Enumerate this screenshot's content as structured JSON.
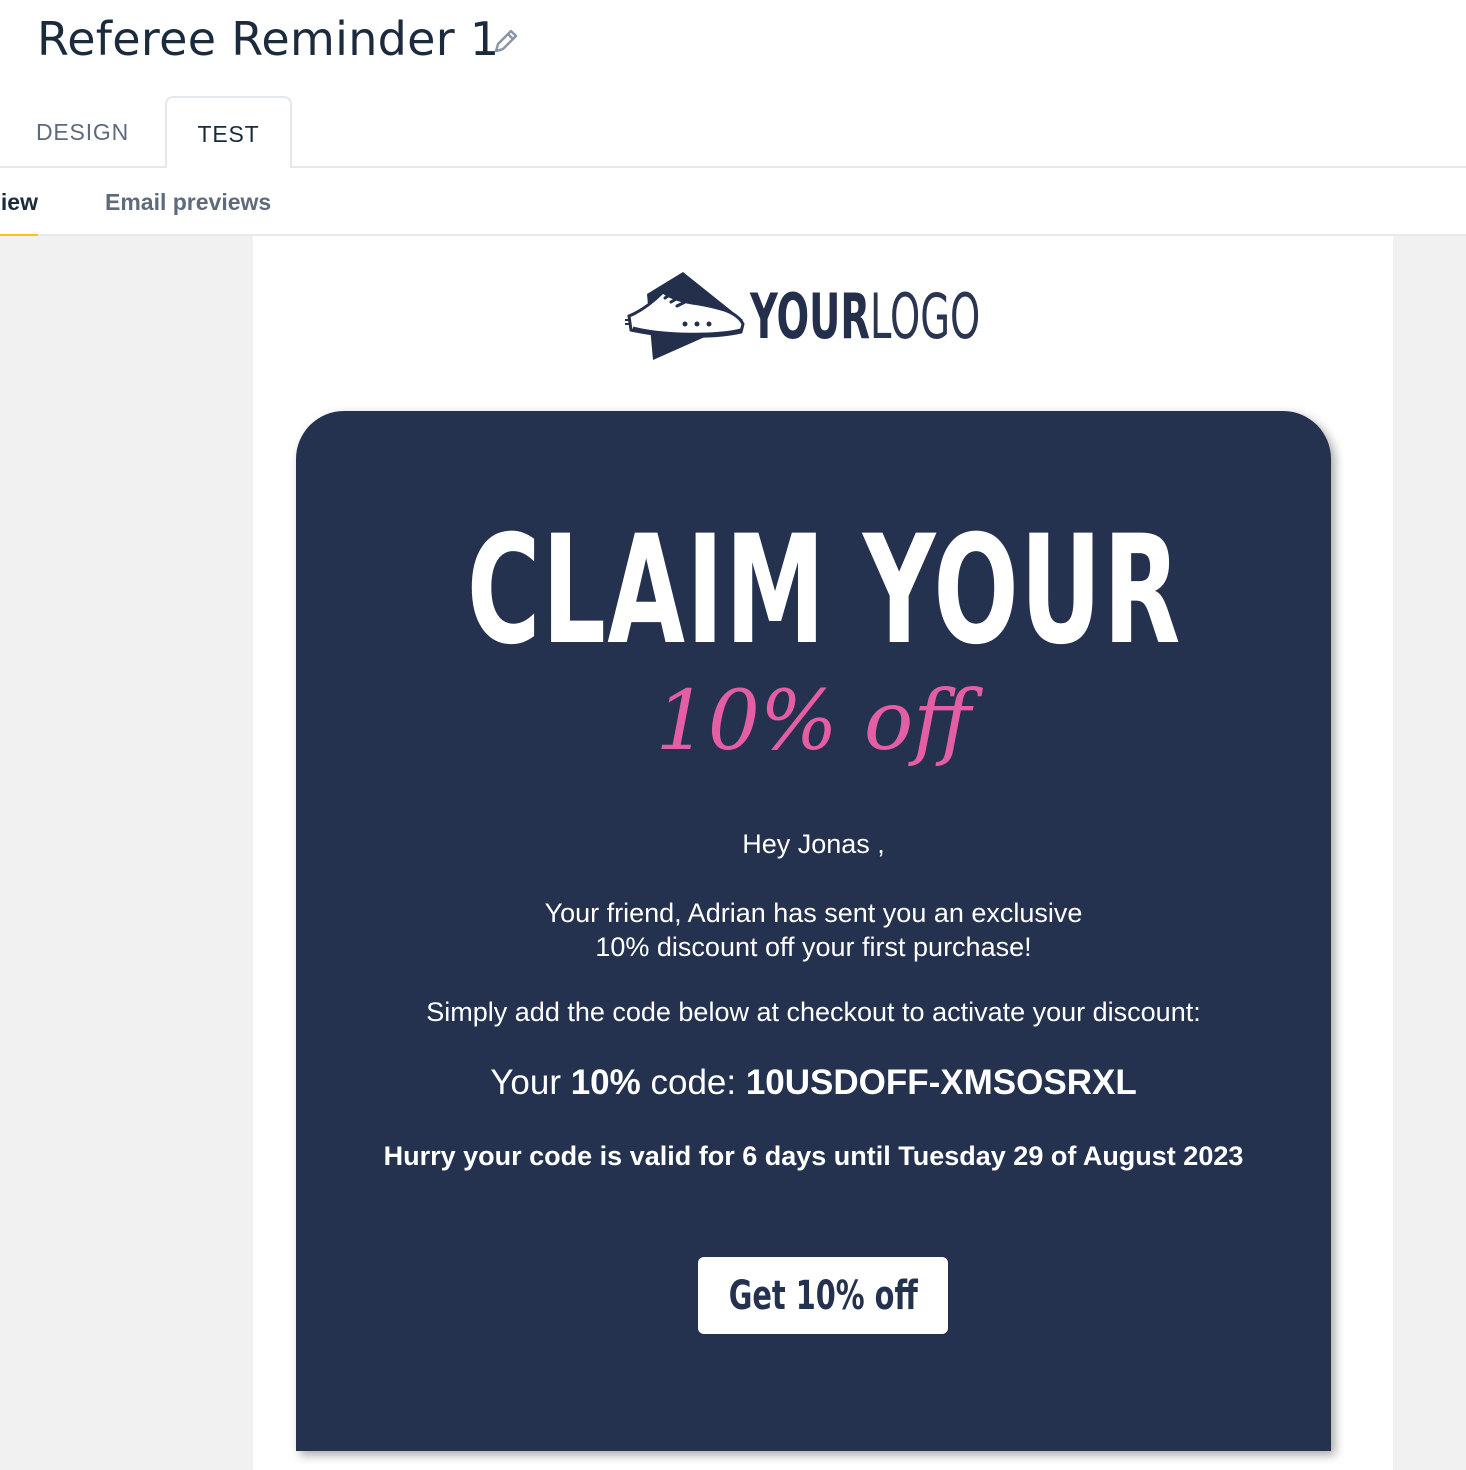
{
  "header": {
    "title": "Referee Reminder 1",
    "edit_icon": "pencil-icon"
  },
  "tabs": [
    {
      "label": "DESIGN",
      "active": false
    },
    {
      "label": "TEST",
      "active": true
    }
  ],
  "subtabs": [
    {
      "label": "iew",
      "active": true
    },
    {
      "label": "Email previews",
      "active": false
    }
  ],
  "colors": {
    "card_background": "#24324f",
    "accent_pink": "#e45ea3",
    "active_underline": "#f5c518",
    "preview_background": "#f1f1f1"
  },
  "email": {
    "logo": {
      "bold": "YOUR",
      "light": "LOGO",
      "icon": "sneaker-icon"
    },
    "headline": "CLAIM YOUR",
    "subheadline": "10% off",
    "greeting": "Hey Jonas ,",
    "message_line1": "Your friend, Adrian has sent you an exclusive",
    "message_line2": "10% discount off your first purchase!",
    "instruction": "Simply add the code below at checkout to activate your discount:",
    "code": {
      "prefix": "Your ",
      "percent": "10%",
      "middle": " code: ",
      "value": "10USDOFF-XMSOSRXL"
    },
    "validity": "Hurry your code is valid for 6 days until Tuesday 29 of August 2023",
    "cta_label": "Get 10% off"
  }
}
